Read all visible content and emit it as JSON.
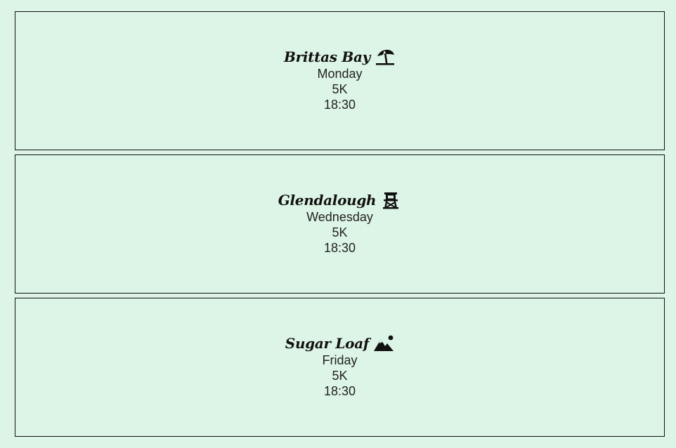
{
  "cards": [
    {
      "title": "Brittas Bay",
      "icon": "beach-umbrella-icon",
      "day": "Monday",
      "distance": "5K",
      "time": "18:30"
    },
    {
      "title": "Glendalough",
      "icon": "tower-icon",
      "day": "Wednesday",
      "distance": "5K",
      "time": "18:30"
    },
    {
      "title": "Sugar Loaf",
      "icon": "mountain-sun-icon",
      "day": "Friday",
      "distance": "5K",
      "time": "18:30"
    }
  ],
  "colors": {
    "background": "#ddf5e6",
    "border": "#111111",
    "text": "#222222"
  }
}
